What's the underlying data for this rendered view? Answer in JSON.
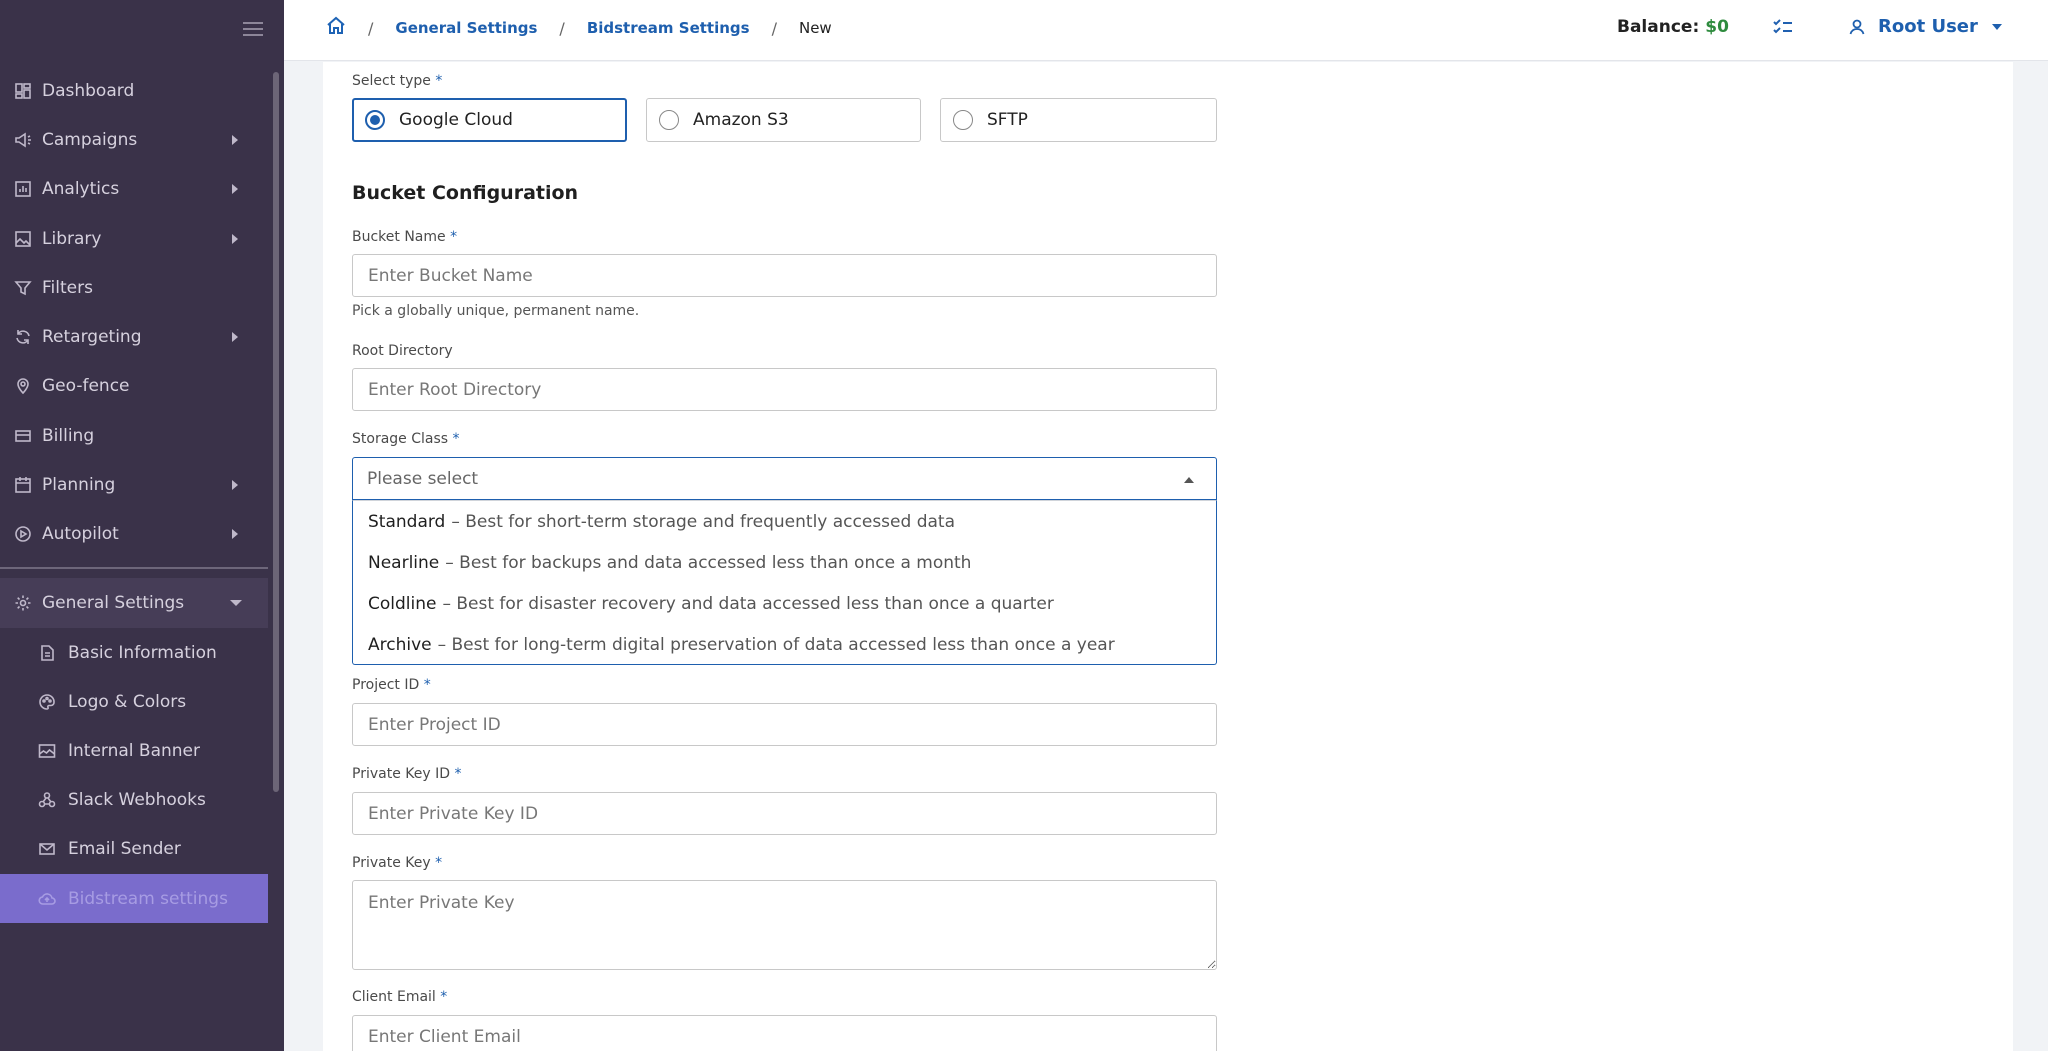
{
  "sidebar": {
    "items": [
      {
        "label": "Dashboard",
        "icon": "dashboard-icon",
        "expandable": false
      },
      {
        "label": "Campaigns",
        "icon": "megaphone-icon",
        "expandable": true
      },
      {
        "label": "Analytics",
        "icon": "bar-chart-icon",
        "expandable": true
      },
      {
        "label": "Library",
        "icon": "image-icon",
        "expandable": true
      },
      {
        "label": "Filters",
        "icon": "filter-icon",
        "expandable": false
      },
      {
        "label": "Retargeting",
        "icon": "refresh-icon",
        "expandable": true
      },
      {
        "label": "Geo-fence",
        "icon": "map-pin-icon",
        "expandable": false
      },
      {
        "label": "Billing",
        "icon": "credit-card-icon",
        "expandable": false
      },
      {
        "label": "Planning",
        "icon": "calendar-icon",
        "expandable": true
      },
      {
        "label": "Autopilot",
        "icon": "play-circle-icon",
        "expandable": true
      }
    ],
    "general_settings": {
      "label": "General Settings",
      "icon": "gear-icon",
      "children": [
        {
          "label": "Basic Information",
          "icon": "document-icon"
        },
        {
          "label": "Logo & Colors",
          "icon": "palette-icon"
        },
        {
          "label": "Internal Banner",
          "icon": "banner-image-icon"
        },
        {
          "label": "Slack Webhooks",
          "icon": "webhook-icon"
        },
        {
          "label": "Email Sender",
          "icon": "mail-icon"
        },
        {
          "label": "Bidstream settings",
          "icon": "cloud-icon",
          "active": true
        }
      ]
    }
  },
  "header": {
    "breadcrumb": [
      "General Settings",
      "Bidstream Settings",
      "New"
    ],
    "balance_label": "Balance:",
    "balance_value": "$0",
    "user_name": "Root User"
  },
  "form": {
    "select_type_label": "Select type",
    "types": [
      {
        "label": "Google Cloud",
        "selected": true
      },
      {
        "label": "Amazon S3",
        "selected": false
      },
      {
        "label": "SFTP",
        "selected": false
      }
    ],
    "section_title": "Bucket Configuration",
    "bucket_name": {
      "label": "Bucket Name",
      "placeholder": "Enter Bucket Name",
      "help": "Pick a globally unique, permanent name."
    },
    "root_directory": {
      "label": "Root Directory",
      "placeholder": "Enter Root Directory"
    },
    "storage_class": {
      "label": "Storage Class",
      "placeholder": "Please select",
      "options": [
        {
          "name": "Standard",
          "desc": "– Best for short-term storage and frequently accessed data"
        },
        {
          "name": "Nearline",
          "desc": "– Best for backups and data accessed less than once a month"
        },
        {
          "name": "Coldline",
          "desc": "– Best for disaster recovery and data accessed less than once a quarter"
        },
        {
          "name": "Archive",
          "desc": "– Best for long-term digital preservation of data accessed less than once a year"
        }
      ]
    },
    "project_id": {
      "label": "Project ID",
      "placeholder": "Enter Project ID"
    },
    "private_key_id": {
      "label": "Private Key ID",
      "placeholder": "Enter Private Key ID"
    },
    "private_key": {
      "label": "Private Key",
      "placeholder": "Enter Private Key"
    },
    "client_email": {
      "label": "Client Email",
      "placeholder": "Enter Client Email"
    },
    "required_mark": "*"
  },
  "colors": {
    "sidebar_bg": "#3a3249",
    "active_item": "#7a6ccc",
    "accent": "#1e5fae",
    "balance": "#2e8b3e"
  }
}
